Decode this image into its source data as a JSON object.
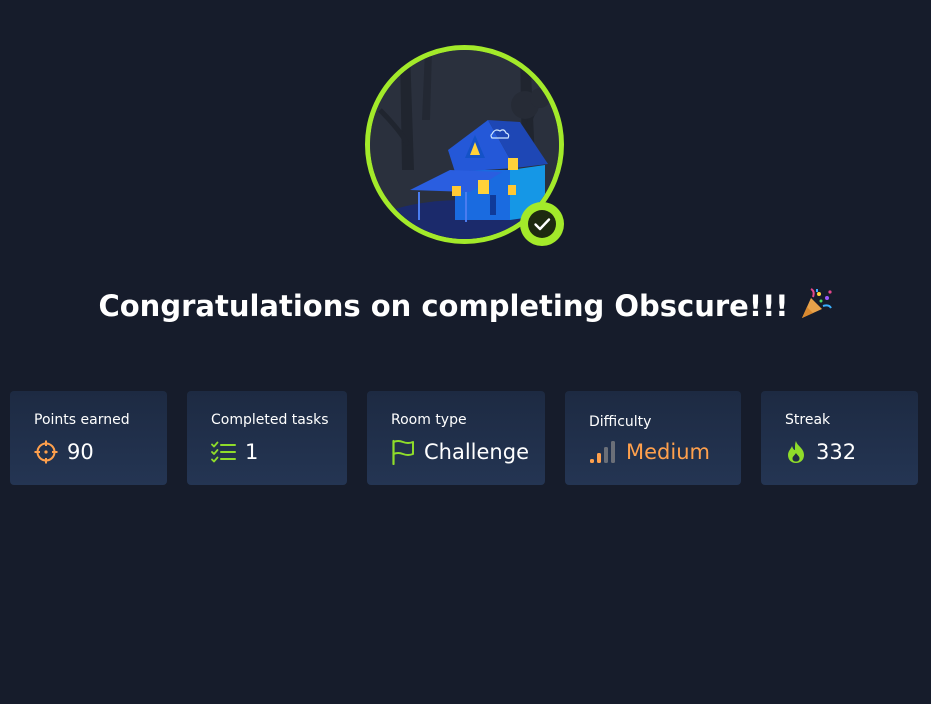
{
  "room": {
    "headline": "Congratulations on completing Obscure!!!",
    "headline_emoji": "party-popper-icon",
    "avatar": "haunted-house-room-icon",
    "completed_badge": "check-icon"
  },
  "stats": {
    "points": {
      "label": "Points earned",
      "value": "90",
      "icon": "crosshair-icon"
    },
    "tasks": {
      "label": "Completed tasks",
      "value": "1",
      "icon": "checklist-icon"
    },
    "room_type": {
      "label": "Room type",
      "value": "Challenge",
      "icon": "flag-icon"
    },
    "difficulty": {
      "label": "Difficulty",
      "value": "Medium",
      "icon": "signal-bars-icon",
      "color": "#ffa04c"
    },
    "streak": {
      "label": "Streak",
      "value": "332",
      "icon": "flame-icon"
    }
  },
  "colors": {
    "background": "#161c2b",
    "accent_green": "#a3ea2a",
    "icon_orange": "#ffa04c",
    "card": "#1d2a42"
  }
}
